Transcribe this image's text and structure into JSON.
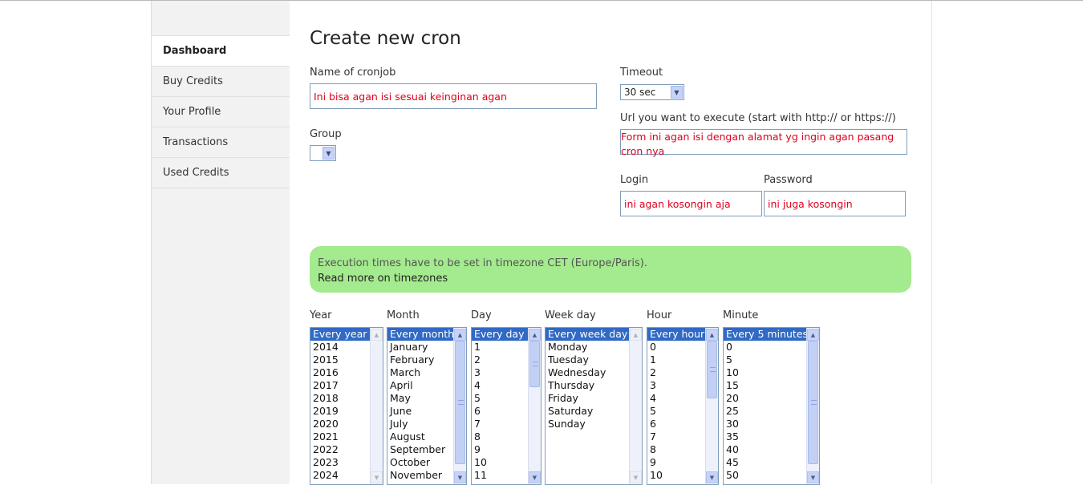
{
  "sidebar": {
    "items": [
      {
        "label": "Dashboard",
        "active": true
      },
      {
        "label": "Buy Credits"
      },
      {
        "label": "Your Profile"
      },
      {
        "label": "Transactions"
      },
      {
        "label": "Used Credits"
      }
    ]
  },
  "form": {
    "title": "Create new cron",
    "name_label": "Name of cronjob",
    "name_value": "Ini bisa agan isi sesuai keinginan agan",
    "group_label": "Group",
    "group_value": "",
    "timeout_label": "Timeout",
    "timeout_value": "30 sec",
    "url_label": "Url you want to execute (start with http:// or https://)",
    "url_value": "Form ini agan isi dengan alamat yg ingin agan pasang cron nya",
    "login_label": "Login",
    "login_value": "ini agan kosongin aja",
    "password_label": "Password",
    "password_value": "ini juga kosongin"
  },
  "notice": {
    "message": "Execution times have to be set in timezone CET (Europe/Paris).",
    "link": "Read more on timezones"
  },
  "schedule": {
    "year": {
      "label": "Year",
      "options": [
        "Every year",
        "2014",
        "2015",
        "2016",
        "2017",
        "2018",
        "2019",
        "2020",
        "2021",
        "2022",
        "2023",
        "2024"
      ]
    },
    "month": {
      "label": "Month",
      "options": [
        "Every month",
        "January",
        "February",
        "March",
        "April",
        "May",
        "June",
        "July",
        "August",
        "September",
        "October",
        "November"
      ]
    },
    "day": {
      "label": "Day",
      "options": [
        "Every day",
        "1",
        "2",
        "3",
        "4",
        "5",
        "6",
        "7",
        "8",
        "9",
        "10",
        "11"
      ]
    },
    "weekday": {
      "label": "Week day",
      "options": [
        "Every week day",
        "Monday",
        "Tuesday",
        "Wednesday",
        "Thursday",
        "Friday",
        "Saturday",
        "Sunday"
      ]
    },
    "hour": {
      "label": "Hour",
      "options": [
        "Every hour",
        "0",
        "1",
        "2",
        "3",
        "4",
        "5",
        "6",
        "7",
        "8",
        "9",
        "10"
      ]
    },
    "minute": {
      "label": "Minute",
      "options": [
        "Every 5 minutes",
        "0",
        "5",
        "10",
        "15",
        "20",
        "25",
        "30",
        "35",
        "40",
        "45",
        "50"
      ]
    }
  },
  "colors": {
    "notice_bg": "#a4ea8e",
    "selected_option": "#316ac5",
    "input_text": "#e0001b"
  },
  "icons": {
    "dropdown": "chevron-down-icon",
    "scroll_up": "scroll-up-icon",
    "scroll_down": "scroll-down-icon"
  }
}
